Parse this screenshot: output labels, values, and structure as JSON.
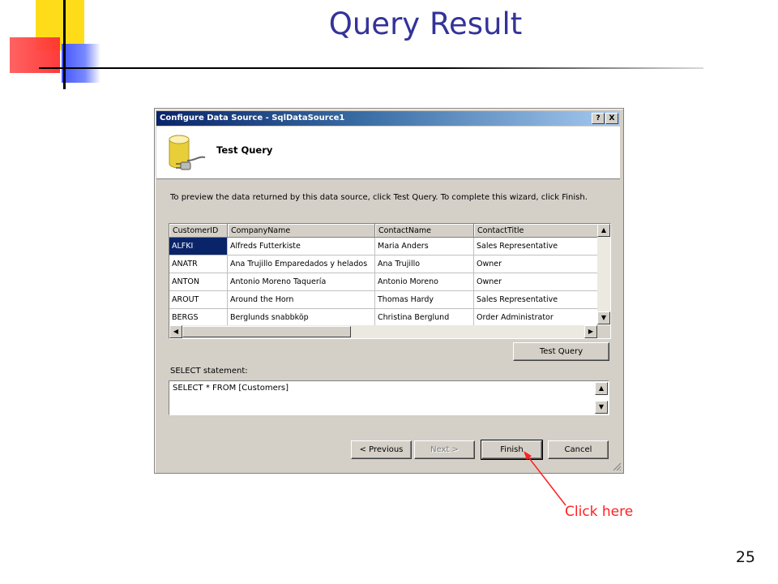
{
  "slide": {
    "title": "Query Result",
    "page_number": "25",
    "annotation": "Click here"
  },
  "dialog": {
    "title": "Configure Data Source - SqlDataSource1",
    "help_button": "?",
    "close_button": "X",
    "header_title": "Test Query",
    "instructions": "To preview the data returned by this data source, click Test Query. To complete this wizard, click Finish.",
    "grid": {
      "columns": [
        "CustomerID",
        "CompanyName",
        "ContactName",
        "ContactTitle"
      ],
      "rows": [
        [
          "ALFKI",
          "Alfreds Futterkiste",
          "Maria Anders",
          "Sales Representative"
        ],
        [
          "ANATR",
          "Ana Trujillo Emparedados y helados",
          "Ana Trujillo",
          "Owner"
        ],
        [
          "ANTON",
          "Antonio Moreno Taquería",
          "Antonio Moreno",
          "Owner"
        ],
        [
          "AROUT",
          "Around the Horn",
          "Thomas Hardy",
          "Sales Representative"
        ],
        [
          "BERGS",
          "Berglunds snabbköp",
          "Christina Berglund",
          "Order Administrator"
        ]
      ]
    },
    "test_query_button": "Test Query",
    "select_label": "SELECT statement:",
    "select_statement": "SELECT * FROM [Customers]",
    "buttons": {
      "previous": "< Previous",
      "next": "Next >",
      "finish": "Finish",
      "cancel": "Cancel"
    }
  }
}
